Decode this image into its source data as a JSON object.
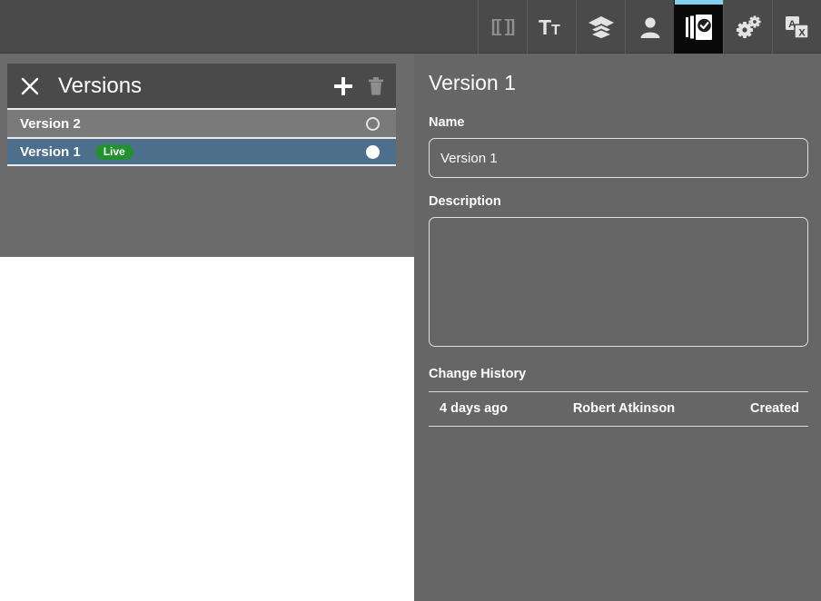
{
  "toolbar": {
    "background_color": "#4a4a4a",
    "active_accent_color": "#7fd3f0",
    "buttons": [
      {
        "name": "placeholders-icon",
        "label": "[[ ]]",
        "active": false
      },
      {
        "name": "text-format-icon",
        "label": "Tt",
        "active": false
      },
      {
        "name": "layers-icon",
        "label": "Layers",
        "active": false
      },
      {
        "name": "user-icon",
        "label": "User",
        "active": false
      },
      {
        "name": "versions-icon",
        "label": "Versions",
        "active": true
      },
      {
        "name": "settings-gears-icon",
        "label": "Settings",
        "active": false
      },
      {
        "name": "translate-icon",
        "label": "Translate",
        "active": false
      }
    ]
  },
  "versions_panel": {
    "title": "Versions",
    "close_label": "✕",
    "add_label": "+",
    "delete_label": "Delete",
    "selected_row_color": "#4d6f8c",
    "live_badge_color": "#249032",
    "items": [
      {
        "label": "Version 2",
        "badge": "",
        "selected": false
      },
      {
        "label": "Version 1",
        "badge": "Live",
        "selected": true
      }
    ]
  },
  "detail_panel": {
    "title": "Version 1",
    "name_label": "Name",
    "name_value": "Version 1",
    "name_placeholder": "",
    "description_label": "Description",
    "description_value": "",
    "description_placeholder": "",
    "change_history_label": "Change History",
    "history_rows": [
      {
        "date": "4 days ago",
        "user": "Robert Atkinson",
        "action": "Created"
      }
    ]
  }
}
